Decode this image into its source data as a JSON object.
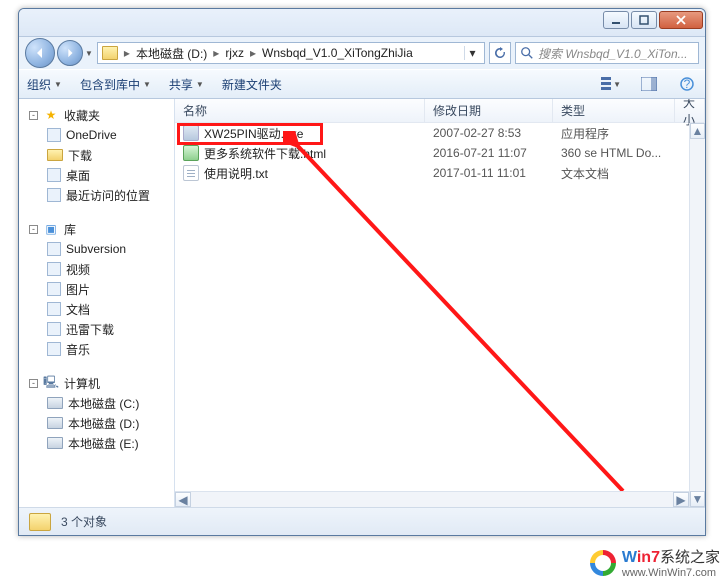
{
  "breadcrumbs": {
    "drive": "本地磁盘 (D:)",
    "p1": "rjxz",
    "p2": "Wnsbqd_V1.0_XiTongZhiJia"
  },
  "search": {
    "placeholder": "搜索 Wnsbqd_V1.0_XiTon..."
  },
  "toolbar": {
    "organize": "组织",
    "include": "包含到库中",
    "share": "共享",
    "newfolder": "新建文件夹"
  },
  "columns": {
    "name": "名称",
    "date": "修改日期",
    "type": "类型",
    "size": "大小"
  },
  "tree": {
    "favorites": {
      "label": "收藏夹",
      "items": [
        "OneDrive",
        "下载",
        "桌面",
        "最近访问的位置"
      ]
    },
    "libraries": {
      "label": "库",
      "items": [
        "Subversion",
        "视频",
        "图片",
        "文档",
        "迅雷下载",
        "音乐"
      ]
    },
    "computer": {
      "label": "计算机",
      "items": [
        "本地磁盘 (C:)",
        "本地磁盘 (D:)",
        "本地磁盘 (E:)"
      ]
    }
  },
  "files": [
    {
      "name": "XW25PIN驱动.exe",
      "date": "2007-02-27 8:53",
      "type": "应用程序",
      "icon": "exe"
    },
    {
      "name": "更多系统软件下载.html",
      "date": "2016-07-21 11:07",
      "type": "360 se HTML Do...",
      "icon": "html"
    },
    {
      "name": "使用说明.txt",
      "date": "2017-01-11 11:01",
      "type": "文本文档",
      "icon": "txt"
    }
  ],
  "status": {
    "count": "3 个对象"
  },
  "watermark": {
    "brand_pre": "W",
    "brand_num": "in7",
    "brand_rest": "系统之家",
    "url": "www.WinWin7.com"
  }
}
